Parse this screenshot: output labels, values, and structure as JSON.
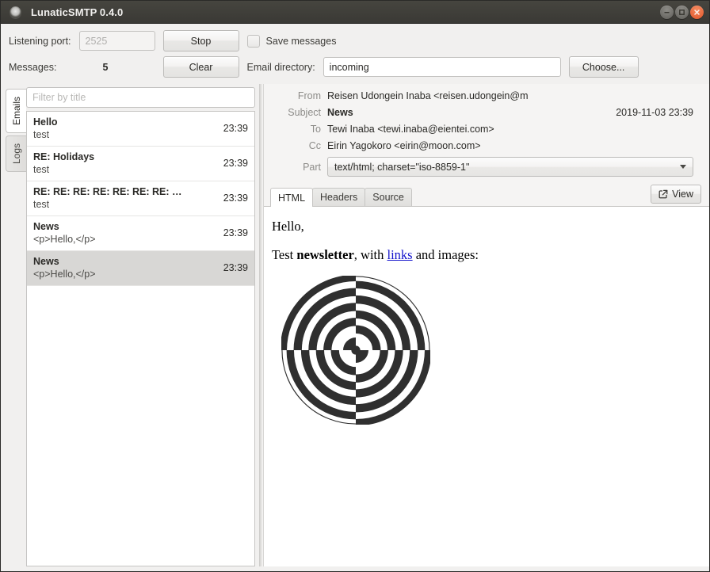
{
  "window": {
    "title": "LunaticSMTP 0.4.0",
    "app_icon": "app-circle-icon",
    "buttons": {
      "minimize": "minimize-icon",
      "maximize": "maximize-icon",
      "close": "close-icon"
    }
  },
  "toolbar": {
    "listening_port_label": "Listening port:",
    "listening_port_value": "2525",
    "stop_label": "Stop",
    "messages_label": "Messages:",
    "messages_count": "5",
    "clear_label": "Clear",
    "save_messages_label": "Save messages",
    "save_messages_checked": false,
    "email_directory_label": "Email directory:",
    "email_directory_value": "incoming",
    "email_directory_placeholder": "",
    "choose_label": "Choose..."
  },
  "vtabs": [
    {
      "label": "Emails",
      "active": true
    },
    {
      "label": "Logs",
      "active": false
    }
  ],
  "list": {
    "filter_placeholder": "Filter by title",
    "filter_value": "",
    "rows": [
      {
        "subject": "Hello",
        "preview": "test",
        "time": "23:39",
        "selected": false
      },
      {
        "subject": "RE: Holidays",
        "preview": "test",
        "time": "23:39",
        "selected": false
      },
      {
        "subject": "RE: RE: RE: RE: RE: RE: RE: …",
        "preview": "test",
        "time": "23:39",
        "selected": false
      },
      {
        "subject": "News",
        "preview": "<p>Hello,</p>",
        "time": "23:39",
        "selected": false
      },
      {
        "subject": "News",
        "preview": "<p>Hello,</p>",
        "time": "23:39",
        "selected": true
      }
    ]
  },
  "message": {
    "from_label": "From",
    "from_value": "Reisen Udongein Inaba <reisen.udongein@m",
    "subject_label": "Subject",
    "subject_value": "News",
    "date_value": "2019-11-03 23:39",
    "to_label": "To",
    "to_value": "Tewi Inaba <tewi.inaba@eientei.com>",
    "cc_label": "Cc",
    "cc_value": "Eirin Yagokoro <eirin@moon.com>",
    "part_label": "Part",
    "part_value": "text/html; charset=\"iso-8859-1\""
  },
  "viewer": {
    "tabs": [
      {
        "label": "HTML",
        "active": true
      },
      {
        "label": "Headers",
        "active": false
      },
      {
        "label": "Source",
        "active": false
      }
    ],
    "view_label": "View",
    "view_icon": "external-link-icon",
    "body": {
      "greeting": "Hello,",
      "line_prefix": "Test ",
      "line_bold": "newsletter",
      "line_mid": ", with ",
      "line_link": "links",
      "line_suffix": " and images:",
      "image_alt": "concentric-target-image"
    }
  },
  "colors": {
    "titlebar": "#3a3935",
    "close_button": "#e8673c",
    "window_bg": "#f1f0ef",
    "selected_row": "#d8d7d5",
    "link": "#1414cc"
  }
}
